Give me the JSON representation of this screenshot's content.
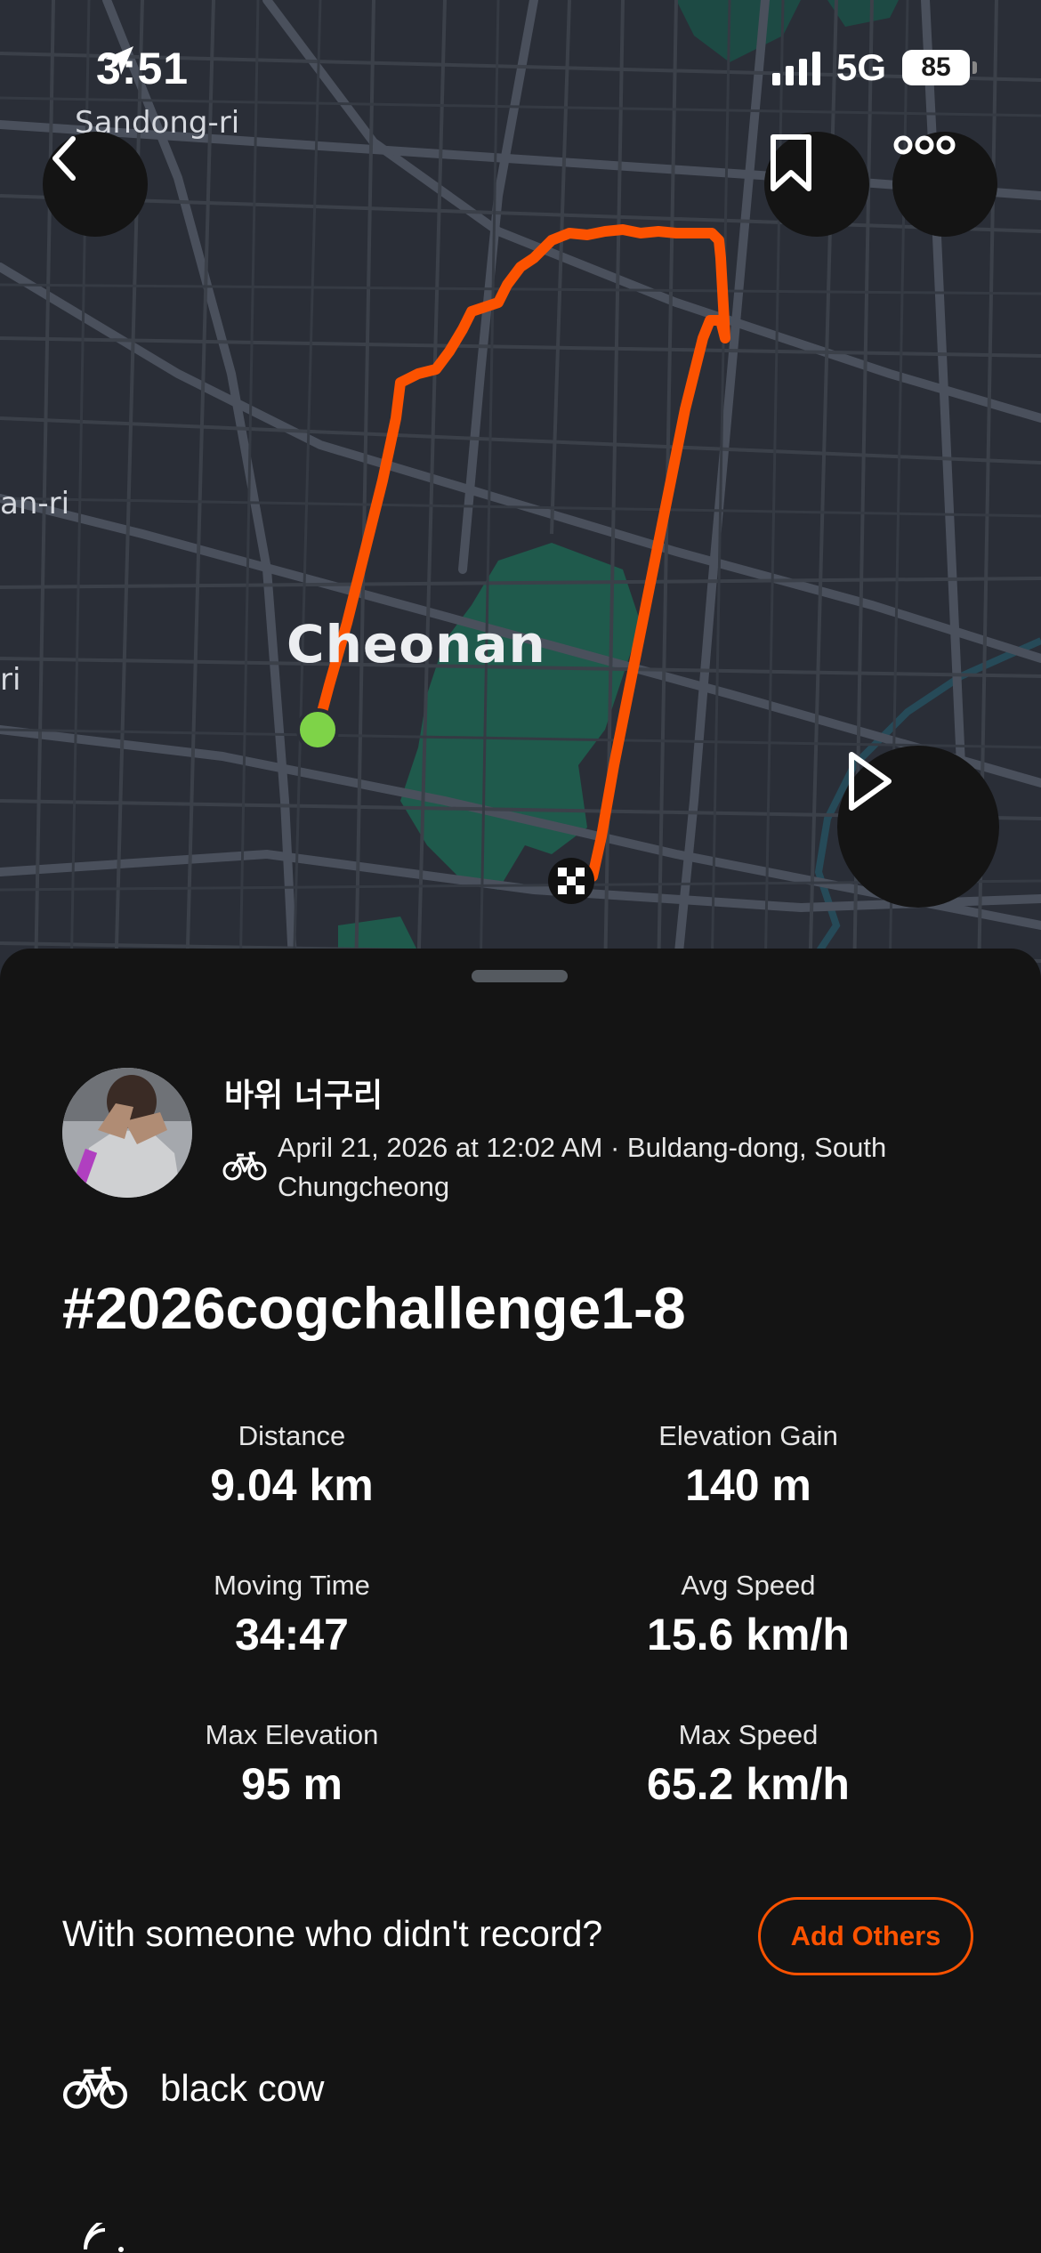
{
  "status_bar": {
    "time": "3:51",
    "network": "5G",
    "battery": "85"
  },
  "map": {
    "labels": {
      "sandong": "Sandong-ri",
      "city": "Cheonan",
      "left_partial_1": "an-ri",
      "left_partial_2": "ri"
    },
    "route_color": "#fc5200",
    "start_marker_color": "#7ed348"
  },
  "controls": {
    "back_icon": "chevron-left-icon",
    "bookmark_icon": "bookmark-icon",
    "more_icon": "more-dots-icon",
    "play_icon": "play-icon"
  },
  "activity": {
    "athlete_name": "바위 너구리",
    "sport_icon": "bike-icon",
    "meta": "April 21, 2026 at 12:02 AM · Buldang-dong, South Chungcheong",
    "title": "#2026cogchallenge1-8"
  },
  "stats": {
    "distance": {
      "label": "Distance",
      "value": "9.04 km"
    },
    "elevation_gain": {
      "label": "Elevation Gain",
      "value": "140 m"
    },
    "moving_time": {
      "label": "Moving Time",
      "value": "34:47"
    },
    "avg_speed": {
      "label": "Avg Speed",
      "value": "15.6 km/h"
    },
    "max_elevation": {
      "label": "Max Elevation",
      "value": "95 m"
    },
    "max_speed": {
      "label": "Max Speed",
      "value": "65.2 km/h"
    }
  },
  "companions": {
    "prompt": "With someone who didn't record?",
    "button": "Add Others"
  },
  "gear": {
    "icon": "bike-icon",
    "name": "black cow"
  },
  "colors": {
    "accent": "#fc5200",
    "background": "#141414",
    "map_background": "#2a2e37",
    "park": "#1f5a4c"
  }
}
